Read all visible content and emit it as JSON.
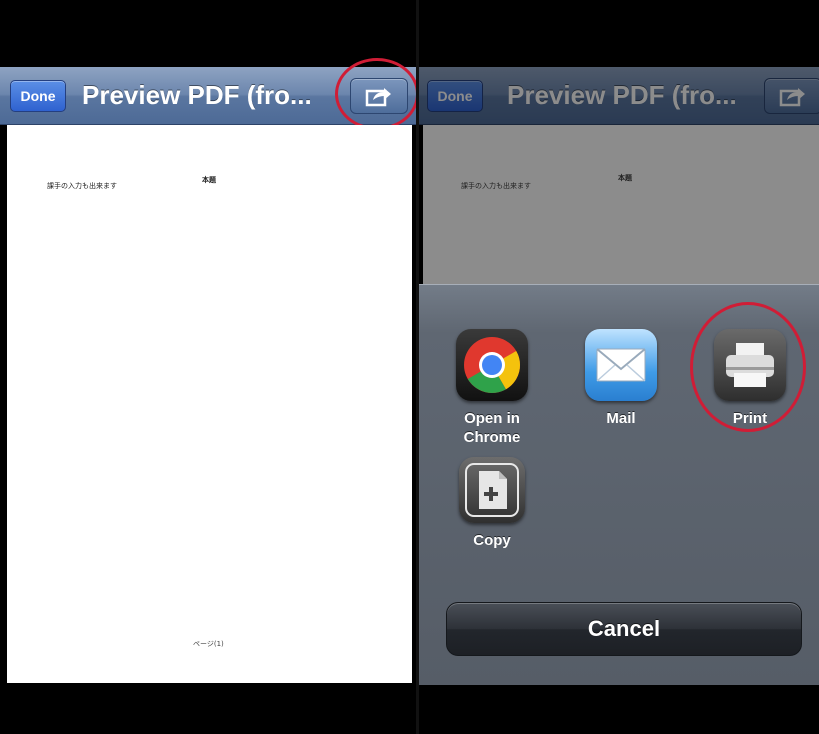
{
  "left_screen": {
    "nav": {
      "done_label": "Done",
      "title": "Preview PDF (fro..."
    },
    "pdf": {
      "line1": "課手の入力も出来ます",
      "line2": "本題",
      "footer": "ページ(1)"
    }
  },
  "right_screen": {
    "nav": {
      "done_label": "Done",
      "title": "Preview PDF (fro..."
    },
    "pdf": {
      "line1": "課手の入力も出来ます",
      "line2": "本題"
    },
    "action_sheet": {
      "actions": [
        {
          "label": "Open in Chrome",
          "icon": "chrome-icon"
        },
        {
          "label": "Mail",
          "icon": "mail-icon"
        },
        {
          "label": "Print",
          "icon": "printer-icon"
        },
        {
          "label": "Copy",
          "icon": "copy-icon"
        }
      ],
      "cancel_label": "Cancel"
    }
  },
  "colors": {
    "highlight_circle": "#d01d36",
    "nav_bar": "#5a76a0",
    "done_button": "#2f62d0"
  }
}
